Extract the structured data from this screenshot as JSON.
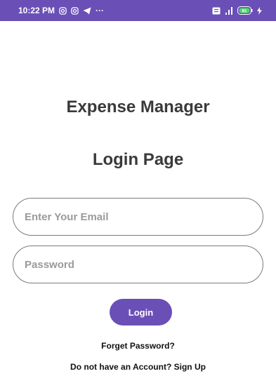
{
  "status_bar": {
    "time": "10:22 PM",
    "more": "···",
    "battery_level": "81",
    "icons_left": [
      "instagram-icon",
      "instagram-icon",
      "telegram-icon"
    ],
    "icons_right": [
      "volte-icon",
      "signal-icon",
      "battery-icon",
      "charging-icon"
    ],
    "color": "#6a4fb6"
  },
  "app": {
    "title": "Expense Manager",
    "page_title": "Login Page"
  },
  "form": {
    "email_placeholder": "Enter Your Email",
    "password_placeholder": "Password",
    "login_label": "Login",
    "forget_password": "Forget Password?",
    "signup_text": "Do not have an Account? Sign Up"
  },
  "colors": {
    "accent": "#6a4fb6",
    "text": "#3a3a3a"
  }
}
